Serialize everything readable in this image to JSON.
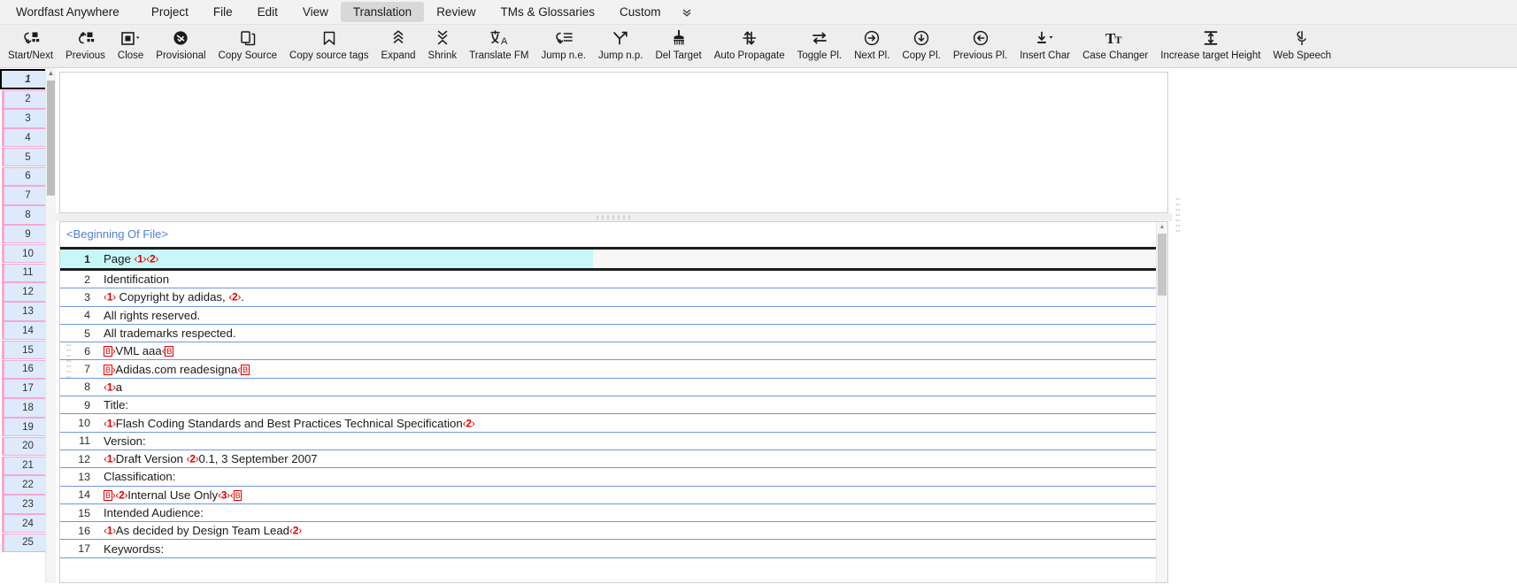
{
  "menubar": {
    "items": [
      {
        "label": "Wordfast Anywhere",
        "active": false
      },
      {
        "label": "Project",
        "active": false
      },
      {
        "label": "File",
        "active": false
      },
      {
        "label": "Edit",
        "active": false
      },
      {
        "label": "View",
        "active": false
      },
      {
        "label": "Translation",
        "active": true
      },
      {
        "label": "Review",
        "active": false
      },
      {
        "label": "TMs & Glossaries",
        "active": false
      },
      {
        "label": "Custom",
        "active": false
      }
    ],
    "overflow_glyph": "»"
  },
  "toolbar": {
    "buttons": [
      {
        "label": "Start/Next",
        "icon": "start-next-icon",
        "caret": false
      },
      {
        "label": "Previous",
        "icon": "previous-icon",
        "caret": false
      },
      {
        "label": "Close",
        "icon": "close-segment-icon",
        "caret": true
      },
      {
        "label": "Provisional",
        "icon": "provisional-icon",
        "caret": false
      },
      {
        "label": "Copy Source",
        "icon": "copy-source-icon",
        "caret": false
      },
      {
        "label": "Copy source tags",
        "icon": "copy-source-tags-icon",
        "caret": false
      },
      {
        "label": "Expand",
        "icon": "expand-icon",
        "caret": false
      },
      {
        "label": "Shrink",
        "icon": "shrink-icon",
        "caret": false
      },
      {
        "label": "Translate FM",
        "icon": "translate-fm-icon",
        "caret": false
      },
      {
        "label": "Jump n.e.",
        "icon": "jump-next-empty-icon",
        "caret": false
      },
      {
        "label": "Jump n.p.",
        "icon": "jump-next-pretranslated-icon",
        "caret": false
      },
      {
        "label": "Del Target",
        "icon": "delete-target-icon",
        "caret": false
      },
      {
        "label": "Auto Propagate",
        "icon": "auto-propagate-icon",
        "caret": false
      },
      {
        "label": "Toggle Pl.",
        "icon": "toggle-placeable-icon",
        "caret": false
      },
      {
        "label": "Next Pl.",
        "icon": "next-placeable-icon",
        "caret": false
      },
      {
        "label": "Copy Pl.",
        "icon": "copy-placeable-icon",
        "caret": false
      },
      {
        "label": "Previous Pl.",
        "icon": "previous-placeable-icon",
        "caret": false
      },
      {
        "label": "Insert Char",
        "icon": "insert-char-icon",
        "caret": true
      },
      {
        "label": "Case Changer",
        "icon": "case-changer-icon",
        "caret": false
      },
      {
        "label": "Increase target Height",
        "icon": "increase-target-height-icon",
        "caret": false
      },
      {
        "label": "Web Speech",
        "icon": "microphone-icon",
        "caret": false
      }
    ]
  },
  "ruler": {
    "current_index": 1,
    "cells": [
      1,
      2,
      3,
      4,
      5,
      6,
      7,
      8,
      9,
      10,
      11,
      12,
      13,
      14,
      15,
      16,
      17,
      18,
      19,
      20,
      21,
      22,
      23,
      24,
      25
    ]
  },
  "grid": {
    "beginning_of_file": "<Beginning Of File>",
    "score_default": "0",
    "rows": [
      {
        "num": "1",
        "score": "0",
        "active": true,
        "parts": [
          {
            "t": "text",
            "v": "Page "
          },
          {
            "t": "tag",
            "v": "1",
            "style": "num"
          },
          {
            "t": "tag",
            "v": "2",
            "style": "num"
          }
        ]
      },
      {
        "num": "2",
        "score": "0",
        "active": false,
        "parts": [
          {
            "t": "text",
            "v": "Identification"
          }
        ]
      },
      {
        "num": "3",
        "score": "0",
        "active": false,
        "parts": [
          {
            "t": "tag",
            "v": "1",
            "style": "num"
          },
          {
            "t": "text",
            "v": " Copyright by adidas, "
          },
          {
            "t": "tag",
            "v": "2",
            "style": "num"
          },
          {
            "t": "text",
            "v": "."
          }
        ]
      },
      {
        "num": "4",
        "score": "0",
        "active": false,
        "parts": [
          {
            "t": "text",
            "v": "All rights reserved."
          }
        ]
      },
      {
        "num": "5",
        "score": "0",
        "active": false,
        "parts": [
          {
            "t": "text",
            "v": "All trademarks respected."
          }
        ]
      },
      {
        "num": "6",
        "score": "0",
        "active": false,
        "parts": [
          {
            "t": "tag",
            "v": "B",
            "style": "open"
          },
          {
            "t": "text",
            "v": "VML aaa"
          },
          {
            "t": "tag",
            "v": "B",
            "style": "close"
          }
        ]
      },
      {
        "num": "7",
        "score": "0",
        "active": false,
        "parts": [
          {
            "t": "tag",
            "v": "B",
            "style": "open"
          },
          {
            "t": "text",
            "v": "Adidas.com readesigna"
          },
          {
            "t": "tag",
            "v": "B",
            "style": "close"
          }
        ]
      },
      {
        "num": "8",
        "score": "0",
        "active": false,
        "parts": [
          {
            "t": "tag",
            "v": "1",
            "style": "num"
          },
          {
            "t": "text",
            "v": "a"
          }
        ]
      },
      {
        "num": "9",
        "score": "0",
        "active": false,
        "parts": [
          {
            "t": "text",
            "v": "Title:"
          }
        ]
      },
      {
        "num": "10",
        "score": "0",
        "active": false,
        "parts": [
          {
            "t": "tag",
            "v": "1",
            "style": "num"
          },
          {
            "t": "text",
            "v": "Flash Coding Standards and Best Practices Technical Specification"
          },
          {
            "t": "tag",
            "v": "2",
            "style": "num"
          }
        ]
      },
      {
        "num": "11",
        "score": "0",
        "active": false,
        "parts": [
          {
            "t": "text",
            "v": "Version:"
          }
        ]
      },
      {
        "num": "12",
        "score": "0",
        "active": false,
        "parts": [
          {
            "t": "tag",
            "v": "1",
            "style": "num"
          },
          {
            "t": "text",
            "v": "Draft Version "
          },
          {
            "t": "tag",
            "v": "2",
            "style": "num"
          },
          {
            "t": "text",
            "v": "0.1, 3 September 2007"
          }
        ]
      },
      {
        "num": "13",
        "score": "0",
        "active": false,
        "parts": [
          {
            "t": "text",
            "v": "Classification:"
          }
        ]
      },
      {
        "num": "14",
        "score": "0",
        "active": false,
        "parts": [
          {
            "t": "tag",
            "v": "B",
            "style": "open"
          },
          {
            "t": "tag",
            "v": "2",
            "style": "num"
          },
          {
            "t": "text",
            "v": "Internal Use Only"
          },
          {
            "t": "tag",
            "v": "3",
            "style": "num"
          },
          {
            "t": "tag",
            "v": "B",
            "style": "close"
          }
        ]
      },
      {
        "num": "15",
        "score": "0",
        "active": false,
        "parts": [
          {
            "t": "text",
            "v": "Intended Audience:"
          }
        ]
      },
      {
        "num": "16",
        "score": "0",
        "active": false,
        "parts": [
          {
            "t": "tag",
            "v": "1",
            "style": "num"
          },
          {
            "t": "text",
            "v": "As decided by Design Team Lead"
          },
          {
            "t": "tag",
            "v": "2",
            "style": "num"
          }
        ]
      },
      {
        "num": "17",
        "score": "0",
        "active": false,
        "parts": [
          {
            "t": "text",
            "v": "Keywordss:"
          }
        ]
      }
    ]
  },
  "colors": {
    "menubar_bg": "#f2f2f2",
    "toolbar_bg": "#eeeeee",
    "active_menu_bg": "#d8d8d8",
    "ruler_cell_fill": "#ddeafb",
    "ruler_cell_border": "#f5a9cd",
    "active_segment_bg": "#c8f7f7",
    "row_separator": "#6f97e0",
    "tag_red": "#e00000",
    "bof_blue": "#4f7fd8"
  }
}
